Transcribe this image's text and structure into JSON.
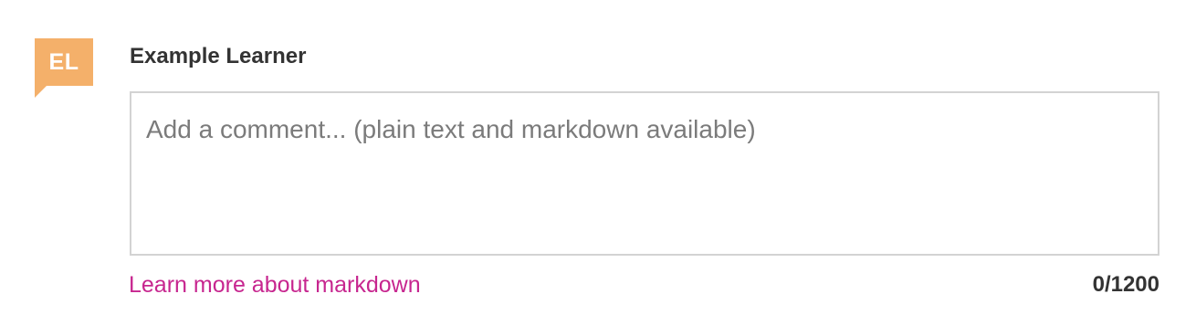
{
  "author": {
    "initials": "EL",
    "name": "Example Learner",
    "avatar_color": "#f4b06a"
  },
  "comment": {
    "value": "",
    "placeholder": "Add a comment... (plain text and markdown available)"
  },
  "footer": {
    "markdown_link_label": "Learn more about markdown",
    "char_count": "0/1200",
    "link_color": "#c7268f"
  }
}
